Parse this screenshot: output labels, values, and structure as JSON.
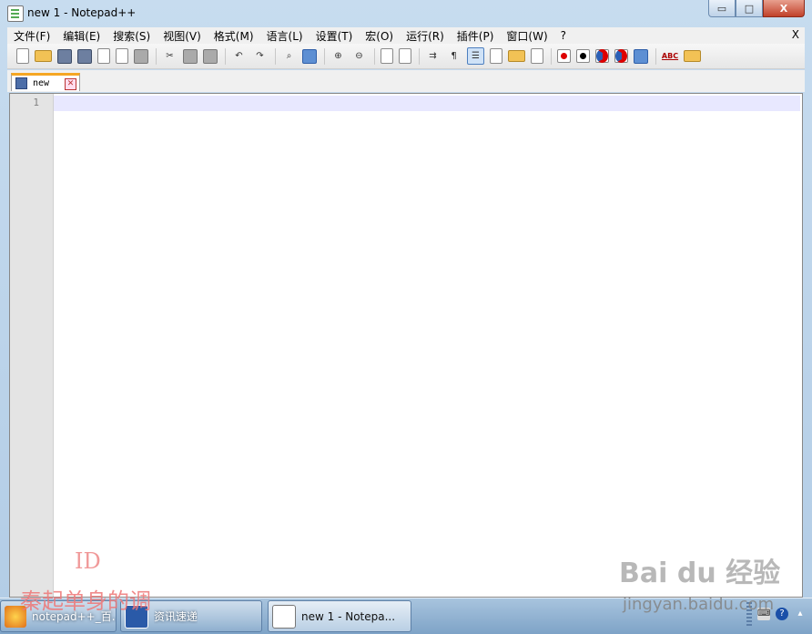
{
  "window": {
    "title": "new  1 - Notepad++",
    "minimize_glyph": "▭",
    "maximize_glyph": "□",
    "close_glyph": "X"
  },
  "menu": {
    "items": [
      "文件(F)",
      "编辑(E)",
      "搜索(S)",
      "视图(V)",
      "格式(M)",
      "语言(L)",
      "设置(T)",
      "宏(O)",
      "运行(R)",
      "插件(P)",
      "窗口(W)",
      "?"
    ],
    "close_label": "X"
  },
  "toolbar": {
    "icons": [
      "new-file-icon",
      "open-file-icon",
      "save-icon",
      "save-all-icon",
      "close-icon",
      "close-all-icon",
      "print-icon",
      "cut-icon",
      "copy-icon",
      "paste-icon",
      "undo-icon",
      "redo-icon",
      "find-icon",
      "replace-icon",
      "zoom-in-icon",
      "zoom-out-icon",
      "sync-vertical-icon",
      "sync-horizontal-icon",
      "word-wrap-icon",
      "show-all-chars-icon",
      "indent-guide-icon",
      "user-defined-language-icon",
      "document-map-icon",
      "function-list-icon",
      "record-macro-icon",
      "stop-record-icon",
      "play-macro-icon",
      "run-macro-multiple-icon",
      "save-macro-icon",
      "spell-check-icon",
      "plugin-icon"
    ],
    "spell_label": "ABC"
  },
  "tabs": [
    {
      "label": "new",
      "close_glyph": "✕"
    }
  ],
  "editor": {
    "line_numbers": [
      "1"
    ]
  },
  "taskbar": {
    "items": [
      {
        "label": "notepad++_百..."
      },
      {
        "label": "资讯速递"
      },
      {
        "label": "new  1 - Notepa..."
      }
    ],
    "help_glyph": "?"
  },
  "watermarks": {
    "id": "ID",
    "text": "秦起单身的调",
    "brand": "Bai du 经验",
    "url": "jingyan.baidu.com"
  }
}
